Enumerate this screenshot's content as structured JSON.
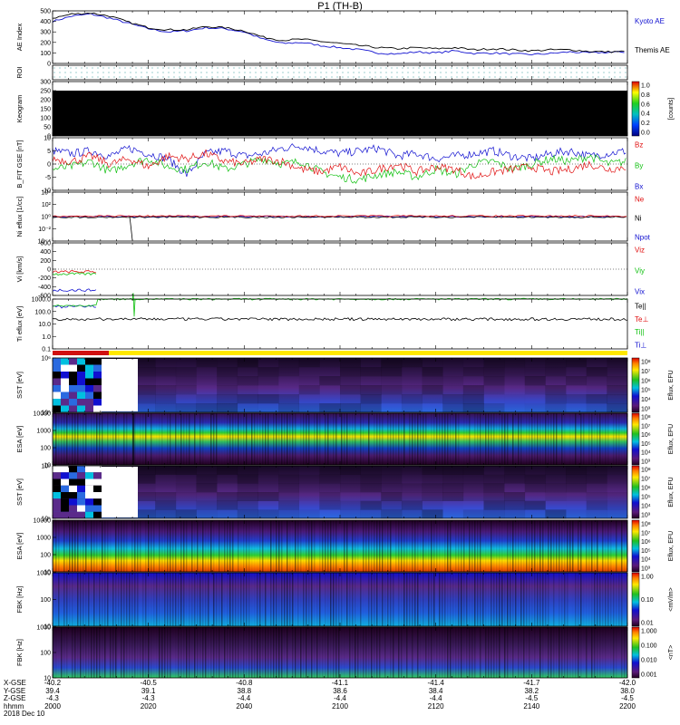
{
  "title": "P1 (TH-B)",
  "colors": {
    "blue": "#1010d0",
    "black": "#000000",
    "red": "#e01010",
    "green": "#10c010",
    "roi_red": "#d01010",
    "roi_yellow": "#ffe800"
  },
  "chart_data": [
    {
      "type": "line",
      "panel": "ae",
      "ylabel": "AE Index",
      "ylim": [
        0,
        500
      ],
      "yticks": [
        "500",
        "400",
        "300",
        "200",
        "100",
        "0"
      ],
      "legend": [
        "Kyoto AE",
        "Themis AE"
      ],
      "series": [
        {
          "name": "Kyoto AE",
          "color": "#1010d0",
          "values": [
            400,
            450,
            470,
            430,
            380,
            330,
            300,
            310,
            340,
            330,
            300,
            230,
            190,
            200,
            170,
            150,
            130,
            100,
            90,
            110,
            100,
            120,
            95,
            100,
            90,
            85,
            95,
            110,
            100,
            105,
            110
          ]
        },
        {
          "name": "Themis AE",
          "color": "#000000",
          "values": [
            430,
            470,
            480,
            450,
            390,
            340,
            320,
            320,
            350,
            340,
            310,
            250,
            220,
            230,
            210,
            190,
            170,
            150,
            140,
            150,
            140,
            150,
            130,
            140,
            130,
            120,
            130,
            130,
            115,
            110,
            115
          ]
        }
      ]
    },
    {
      "type": "heatmap",
      "panel": "roi",
      "ylabel": "ROI"
    },
    {
      "type": "heatmap",
      "panel": "keogram",
      "ylabel": "Keogram",
      "ylim": [
        0,
        300
      ],
      "yticks": [
        "300",
        "250",
        "200",
        "150",
        "100",
        "50",
        "0"
      ],
      "colorbar": {
        "label": "[counts]",
        "ticks": [
          "1.0",
          "0.8",
          "0.6",
          "0.4",
          "0.2",
          "0.0"
        ]
      }
    },
    {
      "type": "line",
      "panel": "bfield",
      "ylabel": "B_FIT GSE [nT]",
      "ylim": [
        -10,
        10
      ],
      "yticks": [
        "10",
        "5",
        "0",
        "-5",
        "-10"
      ],
      "legend": [
        "Bz",
        "By",
        "Bx"
      ],
      "series": [
        {
          "name": "Bz",
          "color": "#e01010",
          "values": [
            2,
            1,
            3,
            0,
            2,
            -1,
            3,
            2,
            4,
            1,
            0,
            2,
            1,
            -2,
            -3,
            -1,
            -4,
            -2,
            0,
            -3,
            -1,
            -2,
            -5,
            -3,
            -2,
            -1,
            -3,
            -2,
            0,
            -2,
            -1
          ]
        },
        {
          "name": "By",
          "color": "#10c010",
          "values": [
            -2,
            -1,
            1,
            -3,
            0,
            2,
            -1,
            -2,
            1,
            -2,
            0,
            2,
            0,
            1,
            -3,
            -5,
            -6,
            -4,
            -3,
            -5,
            -2,
            -4,
            0,
            1,
            -2,
            0,
            2,
            1,
            3,
            0,
            1
          ]
        },
        {
          "name": "Bx",
          "color": "#1010d0",
          "values": [
            5,
            4,
            5,
            3,
            6,
            4,
            2,
            -4,
            4,
            5,
            3,
            4,
            6,
            7,
            5,
            4,
            5,
            6,
            3,
            4,
            2,
            3,
            4,
            5,
            3,
            2,
            4,
            5,
            3,
            4,
            5
          ]
        }
      ]
    },
    {
      "type": "line",
      "panel": "density",
      "ylabel": "Ni eflux [1/cc]",
      "yticks": [
        "10⁴",
        "10²",
        "10⁰",
        "10⁻²",
        "10⁻⁴"
      ],
      "legend": [
        "Ne",
        "Ni",
        "Npot"
      ]
    },
    {
      "type": "line",
      "panel": "velocity",
      "ylabel": "Vi [km/s]",
      "ylim": [
        -600,
        600
      ],
      "yticks": [
        "600",
        "400",
        "200",
        "0",
        "-200",
        "-400",
        "-600"
      ],
      "legend": [
        "Viz",
        "Viy",
        "Vix"
      ]
    },
    {
      "type": "line",
      "panel": "temperature",
      "ylabel": "Ti eflux [eV]",
      "yticks": [
        "1000.0",
        "100.0",
        "10.0",
        "1.0",
        "0.1"
      ],
      "legend": [
        "Te||",
        "Te⊥",
        "Ti||",
        "Ti⊥"
      ]
    },
    {
      "type": "heatmap",
      "panel": "sst_ion",
      "ylabel": "SST [eV]",
      "yticks": [
        "10⁶",
        "10⁵"
      ],
      "colorbar": {
        "label": "Eflux, EFU",
        "ticks": [
          "10⁸",
          "10⁷",
          "10⁶",
          "10⁵",
          "10⁴",
          "10³"
        ]
      }
    },
    {
      "type": "heatmap",
      "panel": "esa_ion",
      "ylabel": "ESA [eV]",
      "yticks": [
        "10000",
        "1000",
        "100",
        "10"
      ],
      "colorbar": {
        "label": "Eflux, EFU",
        "ticks": [
          "10⁸",
          "10⁷",
          "10⁶",
          "10⁵",
          "10⁴",
          "10³"
        ]
      }
    },
    {
      "type": "heatmap",
      "panel": "sst_elec",
      "ylabel": "SST [eV]",
      "yticks": [
        "10⁶",
        "10⁵"
      ],
      "colorbar": {
        "label": "Eflux, EFU",
        "ticks": [
          "10⁸",
          "10⁷",
          "10⁶",
          "10⁵",
          "10⁴",
          "10³"
        ]
      }
    },
    {
      "type": "heatmap",
      "panel": "esa_elec",
      "ylabel": "ESA [eV]",
      "yticks": [
        "10000",
        "1000",
        "100",
        "10"
      ],
      "colorbar": {
        "label": "Eflux, EFU",
        "ticks": [
          "10⁸",
          "10⁷",
          "10⁶",
          "10⁵",
          "10⁴",
          "10³"
        ]
      }
    },
    {
      "type": "heatmap",
      "panel": "fbk_e",
      "ylabel": "FBK [Hz]",
      "yticks": [
        "1000",
        "100",
        "10"
      ],
      "colorbar": {
        "label": "<mV/m>",
        "ticks": [
          "1.00",
          "0.10",
          "0.01"
        ]
      }
    },
    {
      "type": "heatmap",
      "panel": "fbk_b",
      "ylabel": "FBK [Hz]",
      "yticks": [
        "1000",
        "100",
        "10"
      ],
      "colorbar": {
        "label": "<nT>",
        "ticks": [
          "1.000",
          "0.100",
          "0.010",
          "0.001"
        ]
      }
    }
  ],
  "footer": {
    "row_labels": [
      "X-GSE",
      "Y-GSE",
      "Z-GSE",
      "hhmm",
      "2018 Dec 10"
    ],
    "columns": [
      {
        "x": "-40.2",
        "y": "39.4",
        "z": "-4.3",
        "t": "2000"
      },
      {
        "x": "-40.5",
        "y": "39.1",
        "z": "-4.3",
        "t": "2020"
      },
      {
        "x": "-40.8",
        "y": "38.8",
        "z": "-4.4",
        "t": "2040"
      },
      {
        "x": "-41.1",
        "y": "38.6",
        "z": "-4.4",
        "t": "2100"
      },
      {
        "x": "-41.4",
        "y": "38.4",
        "z": "-4.4",
        "t": "2120"
      },
      {
        "x": "-41.7",
        "y": "38.2",
        "z": "-4.5",
        "t": "2140"
      },
      {
        "x": "-42.0",
        "y": "38.0",
        "z": "-4.5",
        "t": "2200"
      }
    ]
  }
}
